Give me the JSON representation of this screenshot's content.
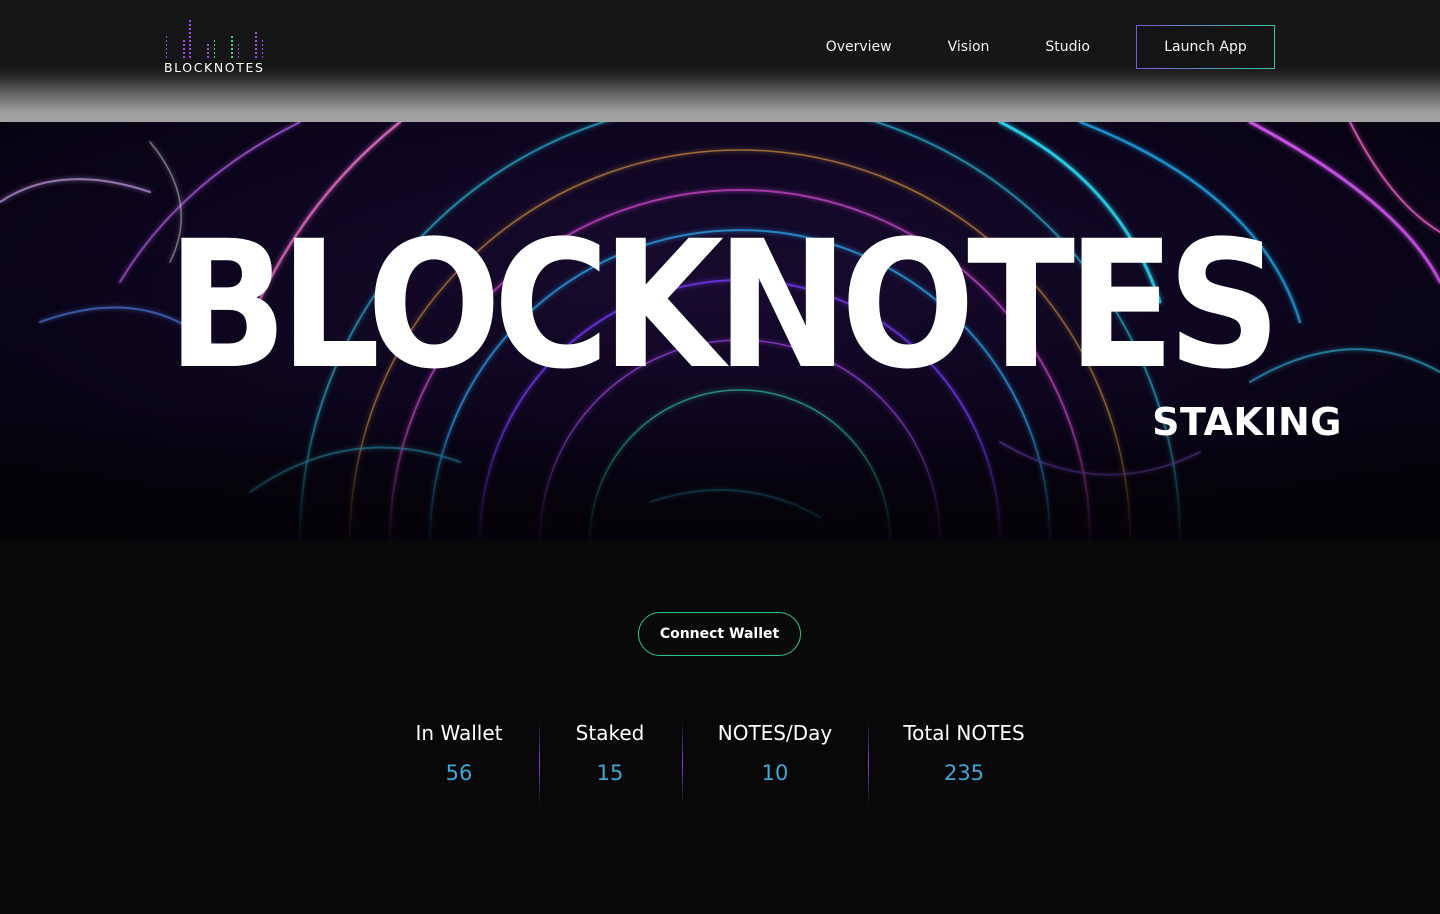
{
  "header": {
    "logo_text": "BLOCKNOTES",
    "nav": [
      {
        "label": "Overview"
      },
      {
        "label": "Vision"
      },
      {
        "label": "Studio"
      }
    ],
    "launch_label": "Launch App"
  },
  "hero": {
    "title": "BLOCKNOTES",
    "subtitle": "STAKING"
  },
  "main": {
    "connect_label": "Connect Wallet",
    "stats": [
      {
        "label": "In Wallet",
        "value": "56"
      },
      {
        "label": "Staked",
        "value": "15"
      },
      {
        "label": "NOTES/Day",
        "value": "10"
      },
      {
        "label": "Total NOTES",
        "value": "235"
      }
    ]
  },
  "colors": {
    "accent_teal": "#27c39b",
    "accent_purple": "#8a3fe0",
    "stat_value_blue": "#3fa6d6",
    "background": "#080808"
  }
}
